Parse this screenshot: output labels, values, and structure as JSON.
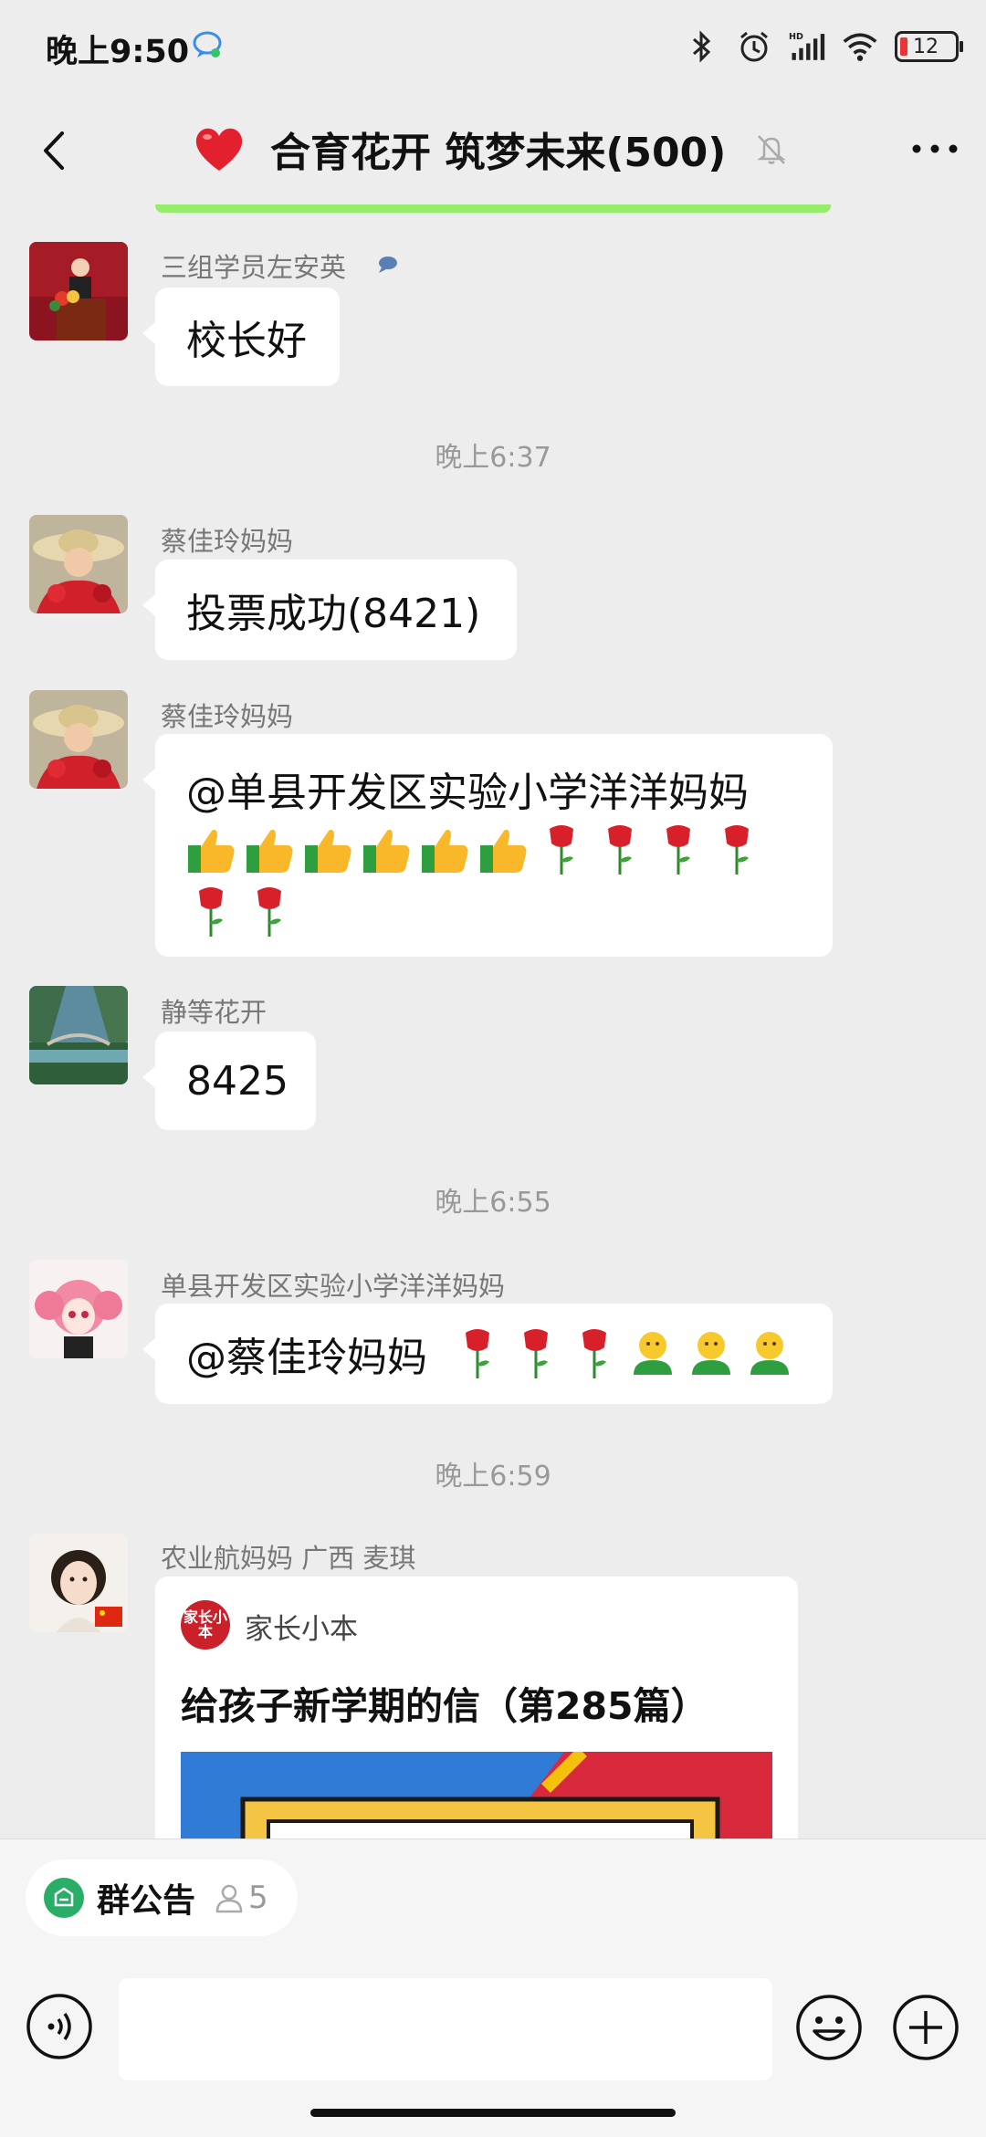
{
  "status_bar": {
    "time": "晚上9:50",
    "battery": "12"
  },
  "header": {
    "title": "合育花开 筑梦未来(500)"
  },
  "messages": [
    {
      "sender": "三组学员左安英",
      "text": "校长好"
    },
    {
      "timestamp": "晚上6:37"
    },
    {
      "sender": "蔡佳玲妈妈",
      "text": "投票成功(8421)"
    },
    {
      "sender": "蔡佳玲妈妈",
      "text": "@单县开发区实验小学洋洋妈妈"
    },
    {
      "sender": "静等花开",
      "text": "8425"
    },
    {
      "timestamp": "晚上6:55"
    },
    {
      "sender": "单县开发区实验小学洋洋妈妈",
      "text": "@蔡佳玲妈妈"
    },
    {
      "timestamp": "晚上6:59"
    },
    {
      "sender": "农业航妈妈 广西  麦琪"
    }
  ],
  "link_card": {
    "logo_text": "家长小本",
    "source": "家长小本",
    "title": "给孩子新学期的信（第285篇）"
  },
  "bottom_bar": {
    "notice_label": "群公告",
    "notice_count": "5"
  },
  "colors": {
    "background": "#ededed",
    "bubble": "#ffffff",
    "accent_green": "#95ec69",
    "timestamp": "#999999"
  },
  "icons": [
    "back-arrow-icon",
    "heart-icon",
    "mute-bell-icon",
    "more-icon",
    "thumbs-up-icon",
    "rose-icon",
    "hug-icon",
    "voice-icon",
    "emoji-icon",
    "plus-icon"
  ]
}
